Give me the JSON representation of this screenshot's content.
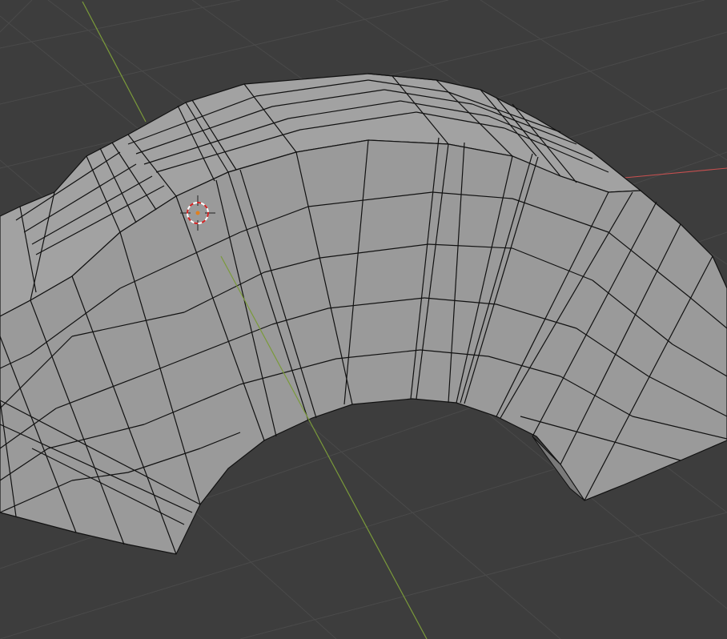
{
  "viewport": {
    "mode": "3d-viewport",
    "background_color": "#3d3d3d",
    "grid_color": "#4a4a4a",
    "axis_x_color": "#c85050",
    "axis_y_color": "#7a9a3a",
    "mesh_face_color": "#9a9a9a",
    "mesh_edge_color": "#111111"
  },
  "cursor": {
    "icon": "3d-cursor-icon"
  },
  "mesh": {
    "name": "curved-mesh-object"
  }
}
